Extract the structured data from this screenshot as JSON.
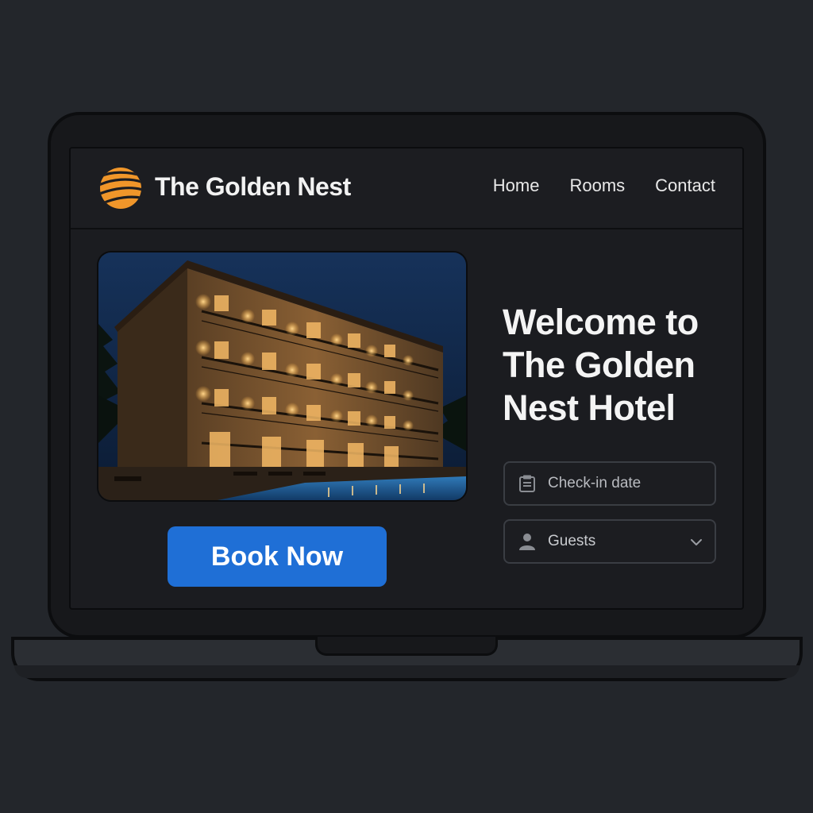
{
  "site": {
    "brand_name": "The Golden Nest",
    "logo_icon": "golden-globe-icon"
  },
  "nav": {
    "items": [
      {
        "label": "Home"
      },
      {
        "label": "Rooms"
      },
      {
        "label": "Contact"
      }
    ]
  },
  "hero": {
    "image_subject": "hotel-building-night-pool",
    "welcome_line_1": "Welcome to",
    "welcome_line_2": "The Golden",
    "welcome_line_3": "Nest Hotel",
    "cta_label": "Book Now"
  },
  "booking": {
    "checkin": {
      "placeholder": "Check-in date",
      "icon": "calendar-icon"
    },
    "guests": {
      "value": "Guests",
      "icon": "user-icon",
      "dropdown_icon": "chevron-down-icon"
    }
  },
  "colors": {
    "page_background": "#23262b",
    "screen_background": "#1b1c20",
    "accent_gold": "#f0962a",
    "button_blue": "#1f6fd6",
    "text_primary": "#f4f4f4",
    "field_border": "#3a3d43"
  }
}
